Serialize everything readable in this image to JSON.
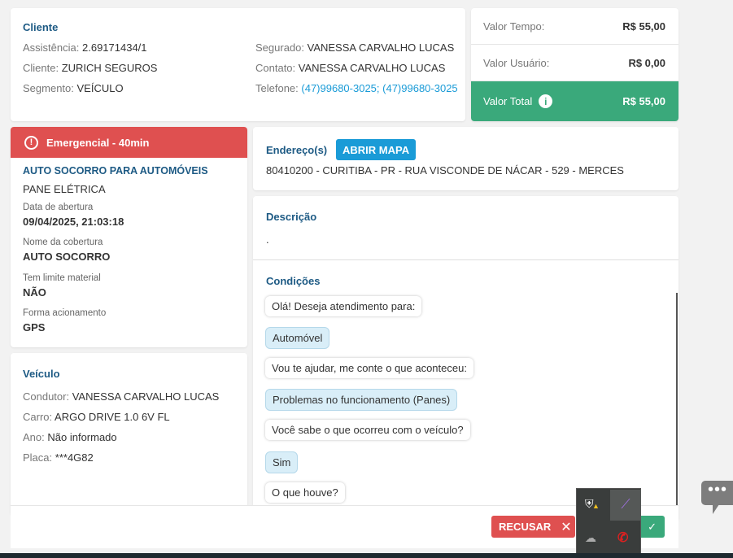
{
  "cliente": {
    "title": "Cliente",
    "assistencia_label": "Assistência:",
    "assistencia": "2.69171434/1",
    "cliente_label": "Cliente:",
    "cliente": "ZURICH SEGUROS",
    "segmento_label": "Segmento:",
    "segmento": "VEÍCULO",
    "segurado_label": "Segurado:",
    "segurado": "VANESSA CARVALHO LUCAS",
    "contato_label": "Contato:",
    "contato": "VANESSA CARVALHO LUCAS",
    "telefone_label": "Telefone:",
    "telefone": "(47)99680-3025; (47)99680-3025"
  },
  "valores": {
    "tempo_label": "Valor Tempo:",
    "tempo": "R$ 55,00",
    "usuario_label": "Valor Usuário:",
    "usuario": "R$ 0,00",
    "total_label": "Valor Total",
    "total": "R$ 55,00"
  },
  "servico": {
    "badge": "Emergencial - 40min",
    "title": "AUTO SOCORRO PARA AUTOMÓVEIS",
    "subtitle": "PANE ELÉTRICA",
    "data_label": "Data de abertura",
    "data": "09/04/2025, 21:03:18",
    "cobertura_label": "Nome da cobertura",
    "cobertura": "AUTO SOCORRO",
    "limite_label": "Tem limite material",
    "limite": "NÃO",
    "forma_label": "Forma acionamento",
    "forma": "GPS"
  },
  "veiculo": {
    "title": "Veículo",
    "condutor_label": "Condutor:",
    "condutor": "VANESSA CARVALHO LUCAS",
    "carro_label": "Carro:",
    "carro": "ARGO DRIVE 1.0 6V FL",
    "ano_label": "Ano:",
    "ano": "Não informado",
    "placa_label": "Placa:",
    "placa": "***4G82"
  },
  "endereco": {
    "title": "Endereço(s)",
    "button": "ABRIR MAPA",
    "value": "80410200 - CURITIBA - PR - RUA VISCONDE DE NÁCAR - 529 - MERCES"
  },
  "descricao": {
    "title": "Descrição",
    "value": "."
  },
  "condicoes": {
    "title": "Condições",
    "messages": [
      {
        "text": "Olá! Deseja atendimento para:"
      },
      {
        "text": "Automóvel"
      },
      {
        "text": "Vou te ajudar, me conte o que aconteceu:"
      },
      {
        "text": "Problemas no funcionamento (Panes)"
      },
      {
        "text": "Você sabe o que ocorreu com o veículo?"
      },
      {
        "text": "Sim"
      },
      {
        "text": "O que houve?"
      }
    ]
  },
  "footer": {
    "recusar": "RECUSAR"
  },
  "colors": {
    "primary": "#1d5a84",
    "danger": "#df5050",
    "success": "#3aa97b",
    "link": "#1a9bd7"
  }
}
